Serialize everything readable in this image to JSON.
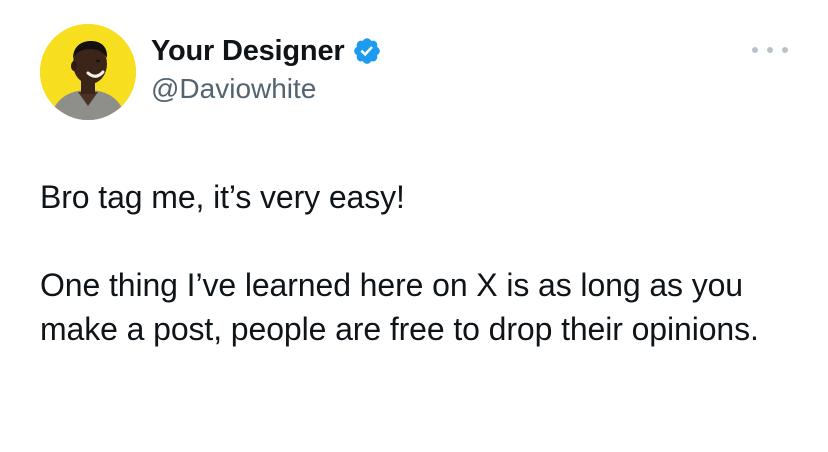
{
  "author": {
    "display_name": "Your Designer",
    "handle": "@Daviowhite",
    "verified": true,
    "avatar_icon": "person-avatar",
    "avatar_background": "#f7df1f"
  },
  "post": {
    "paragraphs": [
      "Bro tag me, it’s very easy!",
      "One thing I’ve learned here on X is as long as you make a post, people are free to drop their opinions."
    ]
  },
  "icons": {
    "verified": "verified-badge-icon",
    "more": "more-options-icon"
  },
  "colors": {
    "text_primary": "#0f1419",
    "text_secondary": "#536471",
    "verified_blue": "#1d9bf0",
    "more_dots": "#b8c2cb"
  }
}
